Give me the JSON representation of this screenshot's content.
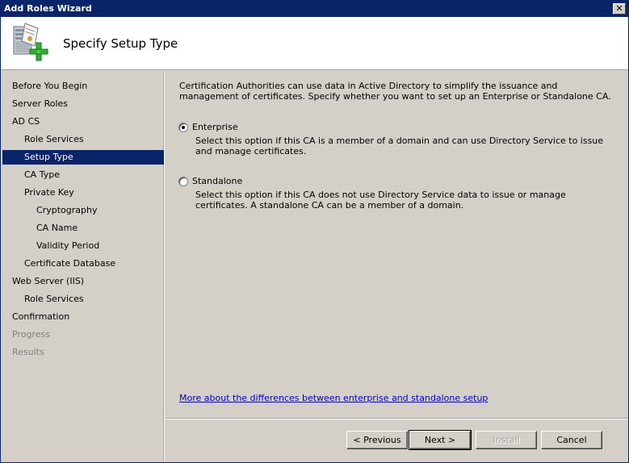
{
  "window": {
    "title": "Add Roles Wizard",
    "close_glyph": "✕"
  },
  "header": {
    "title": "Specify Setup Type",
    "icon": "server-add-icon"
  },
  "nav": {
    "items": [
      {
        "label": "Before You Begin",
        "state": "normal"
      },
      {
        "label": "Server Roles",
        "state": "normal"
      },
      {
        "label": "AD CS",
        "state": "normal"
      },
      {
        "label": "Role Services",
        "state": "normal"
      },
      {
        "label": "Setup Type",
        "state": "selected"
      },
      {
        "label": "CA Type",
        "state": "normal"
      },
      {
        "label": "Private Key",
        "state": "normal"
      },
      {
        "label": "Cryptography",
        "state": "normal"
      },
      {
        "label": "CA Name",
        "state": "normal"
      },
      {
        "label": "Validity Period",
        "state": "normal"
      },
      {
        "label": "Certificate Database",
        "state": "normal"
      },
      {
        "label": "Web Server (IIS)",
        "state": "normal"
      },
      {
        "label": "Role Services",
        "state": "normal"
      },
      {
        "label": "Confirmation",
        "state": "normal"
      },
      {
        "label": "Progress",
        "state": "disabled"
      },
      {
        "label": "Results",
        "state": "disabled"
      }
    ]
  },
  "content": {
    "intro": "Certification Authorities can use data in Active Directory to simplify the issuance and management of certificates. Specify whether you want to set up an Enterprise or Standalone CA.",
    "options": [
      {
        "label": "Enterprise",
        "checked": true,
        "description": "Select this option if this CA is a member of a domain and can use Directory Service to issue and manage certificates."
      },
      {
        "label": "Standalone",
        "checked": false,
        "description": "Select this option if this CA does not use Directory Service data to issue or manage certificates. A standalone CA can be a member of a domain."
      }
    ],
    "link": "More about the differences between enterprise and standalone setup"
  },
  "buttons": {
    "previous": "< Previous",
    "next": "Next >",
    "install": "Install",
    "cancel": "Cancel"
  },
  "colors": {
    "titlebar": "#0a246a",
    "selected": "#0a246a",
    "face": "#d4d0c8",
    "link": "#0000cc"
  }
}
